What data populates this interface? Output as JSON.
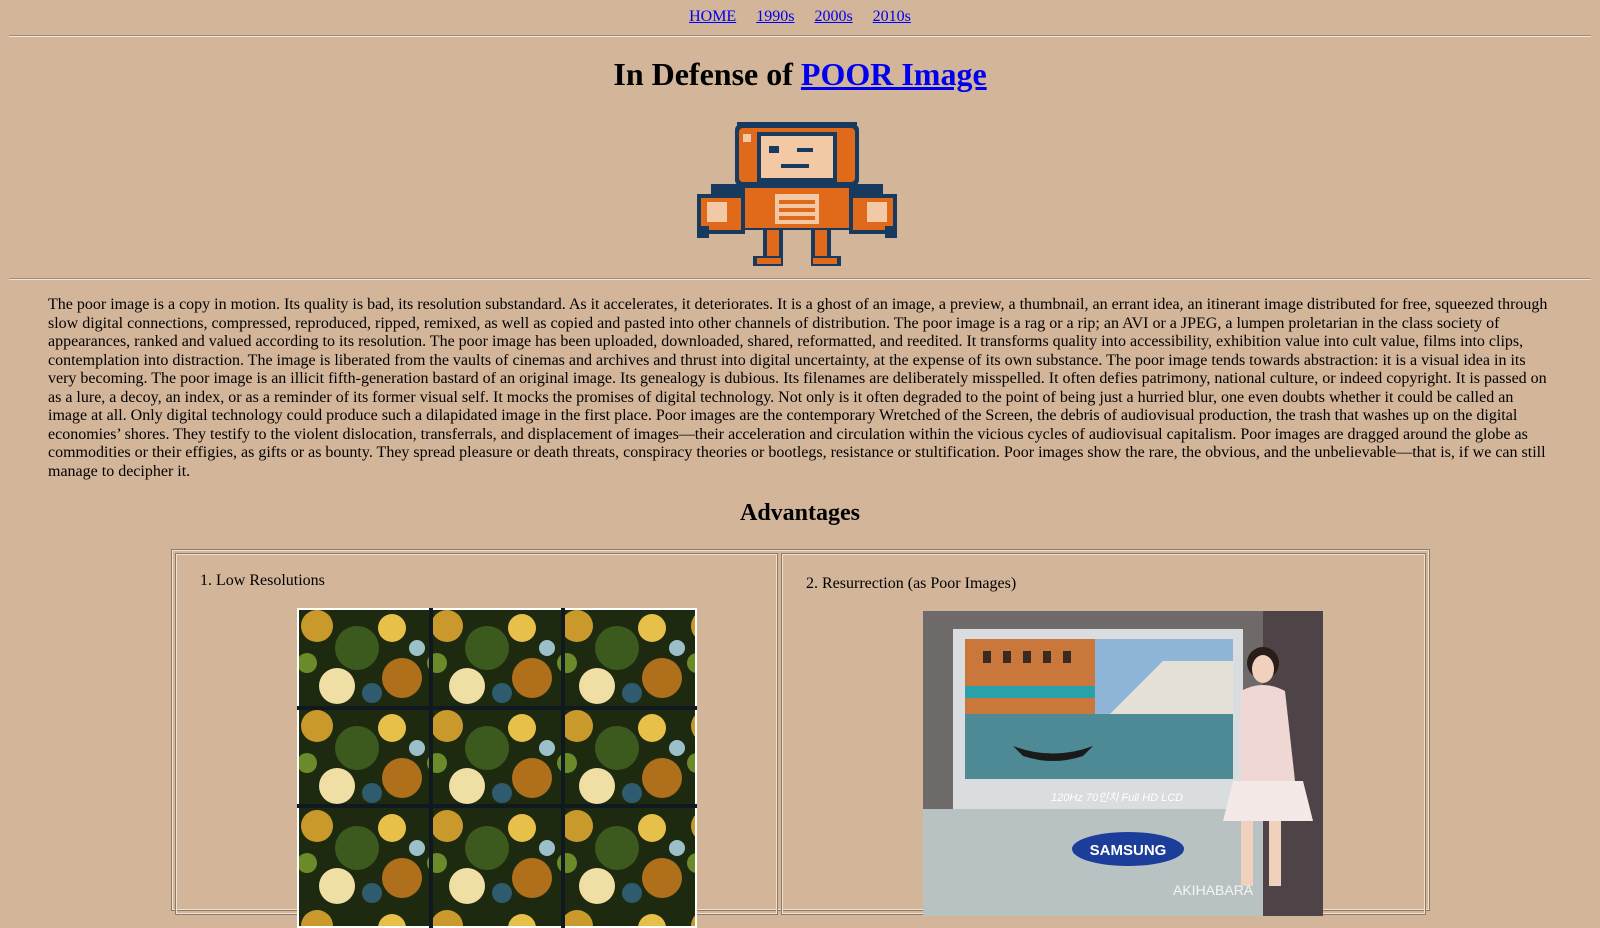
{
  "nav": {
    "links": [
      "HOME",
      "1990s",
      "2000s",
      "2010s"
    ]
  },
  "title": {
    "prefix": "In Defense of",
    "link": "POOR Image"
  },
  "mascot": {
    "icon": "pixel-robot-icon",
    "colors": {
      "orange": "#e06a1a",
      "navy": "#173a5e",
      "peach": "#f3c9a5"
    }
  },
  "intro_text": "The poor image is a copy in motion. Its quality is bad, its resolution substandard. As it accelerates, it deteriorates. It is a ghost of an image, a preview, a thumbnail, an errant idea, an itinerant image distributed for free, squeezed through slow digital connections, compressed, reproduced, ripped, remixed, as well as copied and pasted into other channels of distribution. The poor image is a rag or a rip; an AVI or a JPEG, a lumpen proletarian in the class society of appearances, ranked and valued according to its resolution. The poor image has been uploaded, downloaded, shared, reformatted, and reedited. It transforms quality into accessibility, exhibition value into cult value, films into clips, contemplation into distraction. The image is liberated from the vaults of cinemas and archives and thrust into digital uncertainty, at the expense of its own substance. The poor image tends towards abstraction: it is a visual idea in its very becoming. The poor image is an illicit fifth-generation bastard of an original image. Its genealogy is dubious. Its filenames are deliberately misspelled. It often defies patrimony, national culture, or indeed copyright. It is passed on as a lure, a decoy, an index, or as a reminder of its former visual self. It mocks the promises of digital technology. Not only is it often degraded to the point of being just a hurried blur, one even doubts whether it could be called an image at all. Only digital technology could produce such a dilapidated image in the first place. Poor images are the contemporary Wretched of the Screen, the debris of audiovisual production, the trash that washes up on the digital economies’ shores. They testify to the violent dislocation, transferrals, and displacement of images—their acceleration and circulation within the vicious cycles of audiovisual capitalism. Poor images are dragged around the globe as commodities or their effigies, as gifts or as bounty. They spread pleasure or death threats, conspiracy theories or bootlegs, resistance or stultification. Poor images show the rare, the obvious, and the unbelievable—that is, if we can still manage to decipher it.",
  "advantages": {
    "heading": "Advantages",
    "items": [
      {
        "label": "1. Low Resolutions"
      },
      {
        "label": "2. Resurrection (as Poor Images)",
        "tv_caption": "120Hz 70인치 Full HD LCD",
        "brand": "SAMSUNG",
        "watermark": "AKIHABARA"
      }
    ]
  }
}
